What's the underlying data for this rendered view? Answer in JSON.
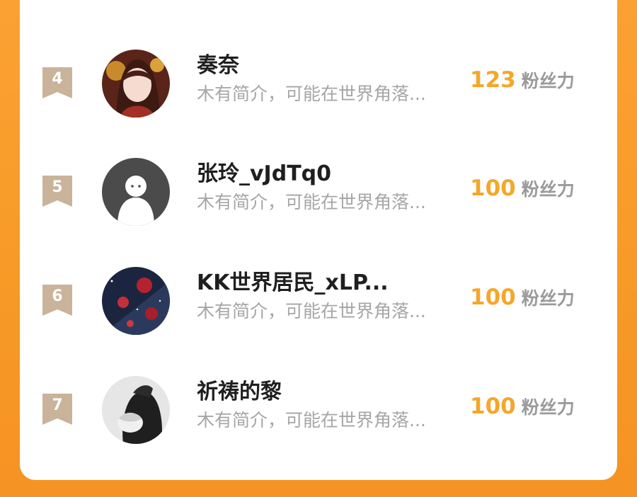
{
  "ranking": {
    "entries": [
      {
        "rank": "4",
        "name": "奏奈",
        "bio": "木有简介，可能在世界角落...",
        "fans_count": "123",
        "fans_unit": "粉丝力"
      },
      {
        "rank": "5",
        "name": "张玲_vJdTq0",
        "bio": "木有简介，可能在世界角落...",
        "fans_count": "100",
        "fans_unit": "粉丝力"
      },
      {
        "rank": "6",
        "name": "KK世界居民_xLP...",
        "bio": "木有简介，可能在世界角落...",
        "fans_count": "100",
        "fans_unit": "粉丝力"
      },
      {
        "rank": "7",
        "name": "祈祷的黎",
        "bio": "木有简介，可能在世界角落...",
        "fans_count": "100",
        "fans_unit": "粉丝力"
      }
    ]
  },
  "colors": {
    "background_orange": "#f79a26",
    "card": "#ffffff",
    "fans_number": "#f4a72a",
    "rank_badge": "#c9b39a",
    "bio_text": "#a6a6a6"
  },
  "icons": {
    "rank_badge": "rank-ribbon-icon"
  }
}
